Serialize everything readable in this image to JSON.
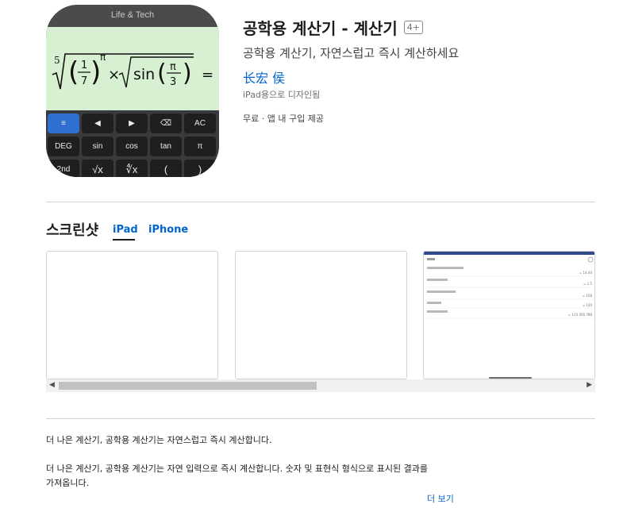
{
  "app": {
    "icon_brand": "Life & Tech",
    "title": "공학용 계산기 - 계산기",
    "age_rating": "4+",
    "subtitle": "공학용 계산기, 자연스럽고 즉시 계산하세요",
    "developer": "长宏 侯",
    "designed_for": "iPad용으로 디자인됨",
    "price_info": "무료 · 앱 내 구입 제공"
  },
  "icon_keys": {
    "row1": [
      "≡",
      "◀",
      "▶",
      "⌫",
      "AC"
    ],
    "row2": [
      "DEG",
      "sin",
      "cos",
      "tan",
      "π"
    ],
    "row3": [
      "2nd",
      "√x",
      "∜x",
      "(",
      ")"
    ]
  },
  "screenshots": {
    "heading": "스크린샷",
    "tabs": [
      "iPad",
      "iPhone"
    ],
    "active_tab": "iPad",
    "preview_rows": [
      {
        "result": "= 14.44"
      },
      {
        "result": "= 1.5"
      },
      {
        "result": "= 158"
      },
      {
        "result": "= 120"
      },
      {
        "result": "= 123 456 789"
      }
    ]
  },
  "description": {
    "line1": "더 나은 계산기, 공학용 계산기는 자연스럽고 즉시 계산합니다.",
    "line2": "더 나은 계산기, 공학용 계산기는 자연 입력으로 즉시 계산합니다. 숫자 및 표현식 형식으로 표시된 결과를 가져옵니다.",
    "more_label": "더 보기"
  },
  "colors": {
    "accent": "#0066cc",
    "icon_display": "#d8f0d2",
    "icon_key_blue": "#2f6fd1"
  }
}
